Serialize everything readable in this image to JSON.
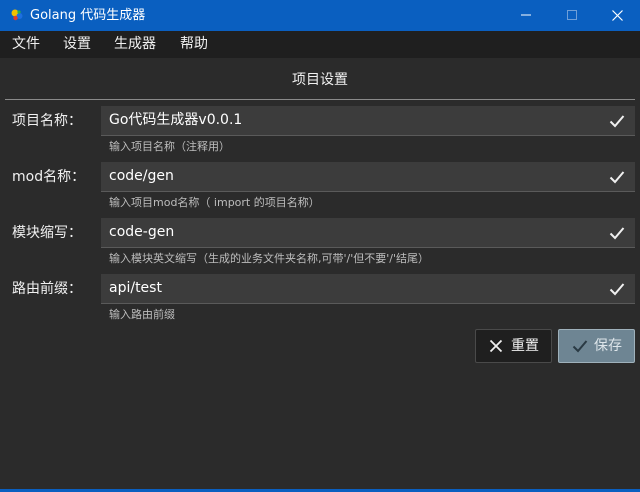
{
  "window": {
    "title": "Golang 代码生成器",
    "accent": "#0a5fc0",
    "controls": [
      "minimize-icon",
      "maximize-icon",
      "close-icon"
    ]
  },
  "menu": {
    "items": [
      "文件",
      "设置",
      "生成器",
      "帮助"
    ]
  },
  "form": {
    "title": "项目设置",
    "fields": [
      {
        "label": "项目名称：",
        "value": "Go代码生成器v0.0.1",
        "hint": "输入项目名称（注释用）"
      },
      {
        "label": "mod名称：",
        "value": "code/gen",
        "hint": "输入项目mod名称（ import 的项目名称）"
      },
      {
        "label": "模块缩写：",
        "value": "code-gen",
        "hint": "输入模块英文缩写（生成的业务文件夹名称,可带'/'但不要'/'结尾）"
      },
      {
        "label": "路由前缀：",
        "value": "api/test",
        "hint": "输入路由前缀"
      }
    ]
  },
  "actions": {
    "reset_label": "重置",
    "save_label": "保存"
  }
}
